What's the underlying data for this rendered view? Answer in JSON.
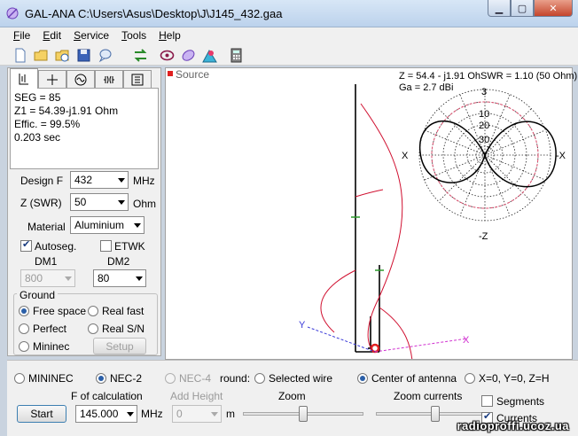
{
  "window": {
    "title": "GAL-ANA C:\\Users\\Asus\\Desktop\\J\\J145_432.gaa"
  },
  "menu": [
    {
      "label": "File",
      "accel": "F",
      "rest": "ile"
    },
    {
      "label": "Edit",
      "accel": "E",
      "rest": "dit"
    },
    {
      "label": "Service",
      "accel": "S",
      "rest": "ervice"
    },
    {
      "label": "Tools",
      "accel": "T",
      "rest": "ools"
    },
    {
      "label": "Help",
      "accel": "H",
      "rest": "elp"
    }
  ],
  "toolbar": [
    "new-file-icon",
    "open-folder-icon",
    "open-recent-icon",
    "save-icon",
    "comment-icon",
    "calculate-icon",
    "antenna-view-icon",
    "pattern-icon",
    "3d-pattern-icon",
    "calculator-icon"
  ],
  "tabs": [
    "wire-geometry-icon",
    "axis-icon",
    "source-icon",
    "load-icon",
    "segments-icon"
  ],
  "info": {
    "seg": "SEG = 85",
    "z1": "Z1 = 54.39-j1.91 Ohm",
    "effic": "Effic. = 99.5%",
    "time": "0.203 sec"
  },
  "design": {
    "freq_label": "Design F",
    "freq_value": "432",
    "freq_unit": "MHz",
    "z_label": "Z (SWR)",
    "z_value": "50",
    "z_unit": "Ohm",
    "material_label": "Material",
    "material_value": "Aluminium",
    "autoseg_label": "Autoseg.",
    "autoseg_checked": true,
    "etwk_label": "ETWK",
    "etwk_checked": false,
    "dm1_label": "DM1",
    "dm1_value": "800",
    "dm2_label": "DM2",
    "dm2_value": "80"
  },
  "ground": {
    "title": "Ground",
    "free_space": "Free space",
    "real_fast": "Real fast",
    "perfect": "Perfect",
    "real_sn": "Real S/N",
    "mininec": "Mininec",
    "setup": "Setup",
    "selected": "free_space"
  },
  "canvas": {
    "source_label": "Source",
    "readout_line1": "Z = 54.4 - j1.91 OhSWR = 1.10 (50 Ohm)",
    "readout_line2": "Ga = 2.7 dBi",
    "rings": [
      "3",
      "10",
      "20",
      "30"
    ],
    "axis_x_left": "X",
    "axis_x_right": "-X",
    "axis_z_bottom": "-Z",
    "axis_y": "Y",
    "axis_x_small": "X"
  },
  "bottom": {
    "mininec": "MININEC",
    "nec2": "NEC-2",
    "nec4": "NEC-4",
    "selected_engine": "nec2",
    "ground_label_partial": "round:",
    "selected_wire": "Selected wire",
    "center_antenna": "Center of antenna",
    "origin": "X=0, Y=0, Z=H",
    "center_selected": "center_antenna",
    "f_calc_label": "F of calculation",
    "f_calc_value": "145.000",
    "f_calc_unit": "MHz",
    "add_height_label": "Add Height",
    "add_height_value": "0",
    "add_height_unit": "m",
    "zoom_label": "Zoom",
    "zoom_currents_label": "Zoom currents",
    "zoom_value": 0.5,
    "zoom_currents_value": 0.55,
    "segments_label": "Segments",
    "segments_checked": false,
    "currents_label": "Currents",
    "currents_checked": true,
    "start_label": "Start"
  },
  "watermark": "radioproffi.ucoz.ua"
}
